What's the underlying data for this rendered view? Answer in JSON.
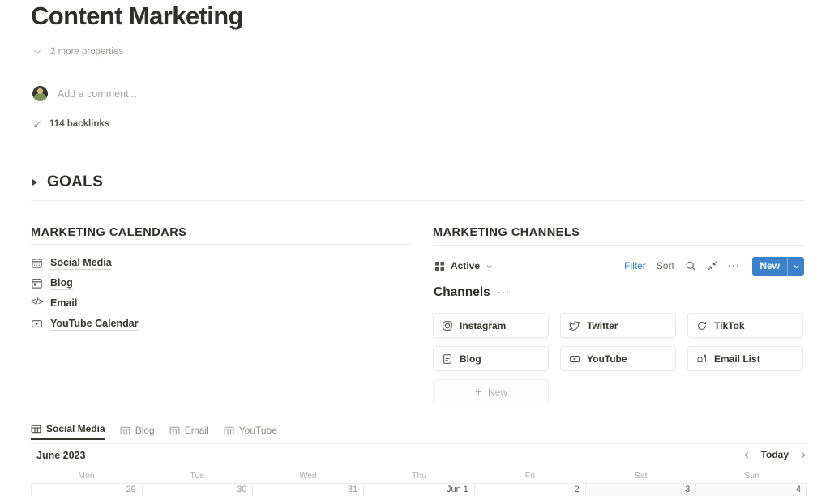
{
  "page": {
    "title": "Content Marketing",
    "properties_toggle": "2 more properties",
    "comment_placeholder": "Add a comment...",
    "backlinks": "114 backlinks",
    "avatar_name": "user-avatar"
  },
  "goals": {
    "label": "GOALS"
  },
  "calendars": {
    "heading": "MARKETING CALENDARS",
    "items": [
      {
        "label": "Social Media",
        "icon": "calendar-icon"
      },
      {
        "label": "Blog",
        "icon": "calendar-icon"
      },
      {
        "label": "Email",
        "icon": "code-icon"
      },
      {
        "label": "YouTube Calendar",
        "icon": "video-icon"
      }
    ]
  },
  "channels": {
    "heading": "MARKETING CHANNELS",
    "toolbar": {
      "view_name": "Active",
      "view_icon": "gallery-grid-icon",
      "filter_label": "Filter",
      "sort_label": "Sort",
      "search_icon": "search-icon",
      "expand_icon": "collapse-arrows-icon",
      "more_icon": "ellipsis-icon",
      "new_label": "New",
      "new_chevron_icon": "chevron-down-icon",
      "accent_color": "#3b82ca",
      "filter_color": "#2f80d2"
    },
    "block_title": "Channels",
    "block_menu_icon": "ellipsis-icon",
    "cards": [
      {
        "label": "Instagram",
        "icon": "instagram-icon"
      },
      {
        "label": "Twitter",
        "icon": "twitter-bird-icon"
      },
      {
        "label": "TikTok",
        "icon": "refresh-circle-icon"
      },
      {
        "label": "Blog",
        "icon": "document-icon"
      },
      {
        "label": "YouTube",
        "icon": "video-icon"
      },
      {
        "label": "Email List",
        "icon": "mailbox-icon"
      }
    ],
    "new_card_label": "New"
  },
  "calendar_view": {
    "tabs": [
      {
        "label": "Social Media",
        "active": true
      },
      {
        "label": "Blog",
        "active": false
      },
      {
        "label": "Email",
        "active": false
      },
      {
        "label": "YouTube",
        "active": false
      }
    ],
    "month": "June 2023",
    "today_label": "Today",
    "prev_icon": "chevron-left-icon",
    "next_icon": "chevron-right-icon",
    "day_headers": [
      "Mon",
      "Tue",
      "Wed",
      "Thu",
      "Fri",
      "Sat",
      "Sun"
    ],
    "days": [
      {
        "label": "29",
        "muted": true,
        "weekend": false
      },
      {
        "label": "30",
        "muted": true,
        "weekend": false
      },
      {
        "label": "31",
        "muted": true,
        "weekend": false
      },
      {
        "label": "Jun 1",
        "muted": false,
        "weekend": false
      },
      {
        "label": "2",
        "muted": false,
        "weekend": false
      },
      {
        "label": "3",
        "muted": false,
        "weekend": true
      },
      {
        "label": "4",
        "muted": false,
        "weekend": true
      }
    ]
  }
}
